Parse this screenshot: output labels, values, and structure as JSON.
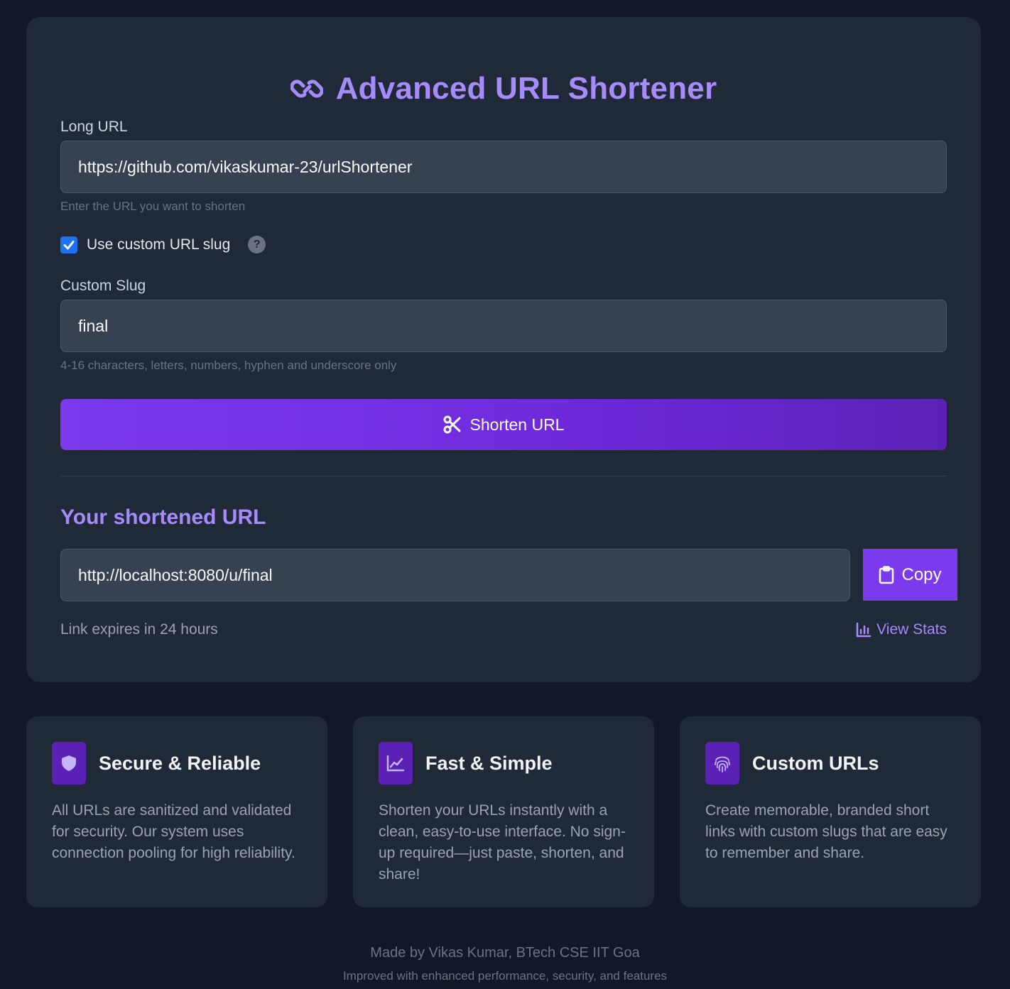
{
  "header": {
    "title": "Advanced URL Shortener",
    "icon": "link-icon"
  },
  "form": {
    "long_url_label": "Long URL",
    "long_url_value": "https://github.com/vikaskumar-23/urlShortener",
    "long_url_hint": "Enter the URL you want to shorten",
    "custom_slug_checkbox_label": "Use custom URL slug",
    "custom_slug_checked": true,
    "help_glyph": "?",
    "custom_slug_label": "Custom Slug",
    "custom_slug_value": "final",
    "custom_slug_hint": "4-16 characters, letters, numbers, hyphen and underscore only",
    "submit_label": "Shorten URL"
  },
  "result": {
    "title": "Your shortened URL",
    "short_url": "http://localhost:8080/u/final",
    "copy_label": "Copy",
    "expires_text": "Link expires in 24 hours",
    "stats_label": "View Stats"
  },
  "features": [
    {
      "icon": "shield-icon",
      "title": "Secure & Reliable",
      "description": "All URLs are sanitized and validated for security. Our system uses connection pooling for high reliability."
    },
    {
      "icon": "chart-line-icon",
      "title": "Fast & Simple",
      "description": "Shorten your URLs instantly with a clean, easy-to-use interface. No sign-up required—just paste, shorten, and share!"
    },
    {
      "icon": "fingerprint-icon",
      "title": "Custom URLs",
      "description": "Create memorable, branded short links with custom slugs that are easy to remember and share."
    }
  ],
  "footer": {
    "credit": "Made by Vikas Kumar, BTech CSE IIT Goa",
    "note": "Improved with enhanced performance, security, and features"
  },
  "colors": {
    "background": "#111827",
    "card": "#1f2937",
    "accent": "#a78bfa",
    "button": "#7c3aed",
    "input": "#374151"
  }
}
